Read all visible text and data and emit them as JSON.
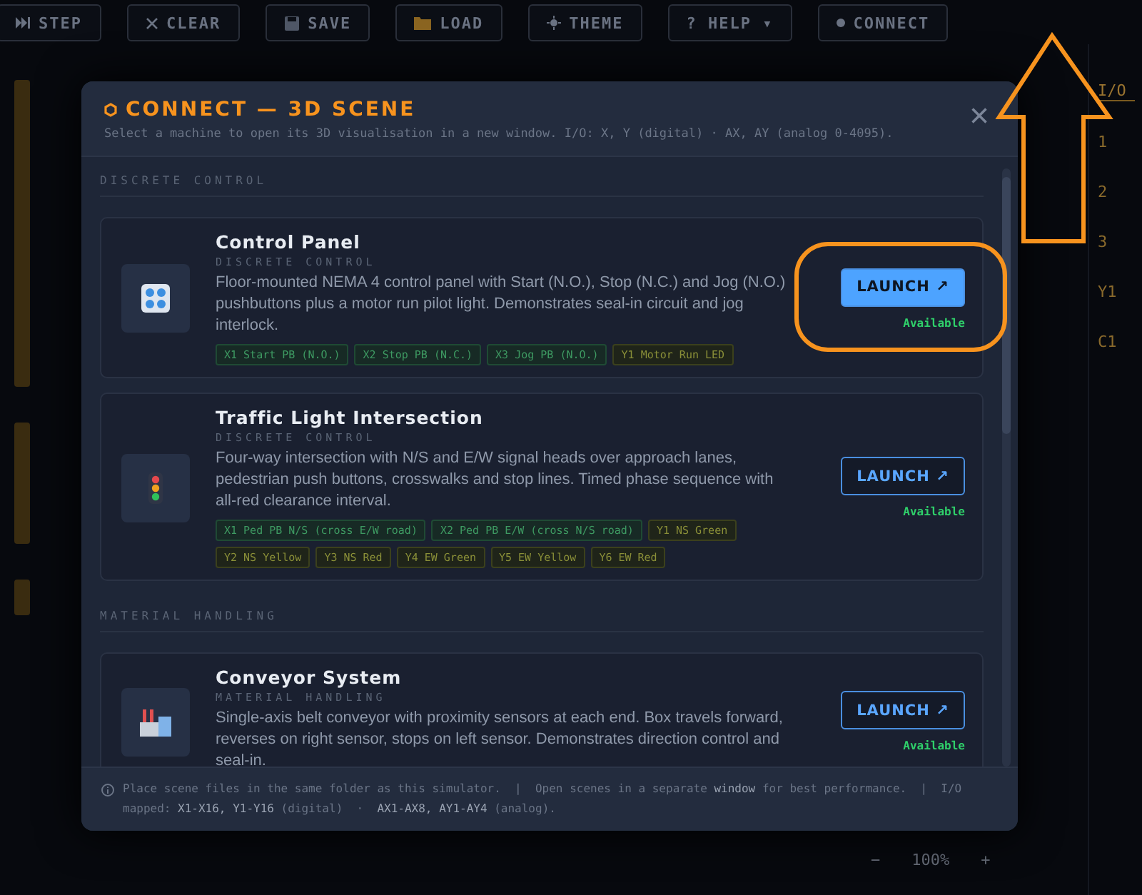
{
  "toolbar": [
    {
      "label": "STEP"
    },
    {
      "label": "CLEAR"
    },
    {
      "label": "SAVE"
    },
    {
      "label": "LOAD"
    },
    {
      "label": "THEME"
    },
    {
      "label": "? HELP ▾"
    },
    {
      "label": "CONNECT"
    }
  ],
  "side_panel": {
    "tab": "I/O",
    "rows": [
      "1",
      "2",
      "3",
      "Y1",
      "C1"
    ]
  },
  "zoom_bar": {
    "minus": "−",
    "value": "100%",
    "plus": "+"
  },
  "modal": {
    "title": "CONNECT — 3D SCENE",
    "subtitle": "Select a machine to open its 3D visualisation in a new window. I/O: X, Y (digital) · AX, AY (analog 0-4095).",
    "close": "×",
    "sections": [
      {
        "heading": "DISCRETE CONTROL",
        "machines": [
          {
            "name": "Control Panel",
            "category": "DISCRETE CONTROL",
            "description": "Floor-mounted NEMA 4 control panel with Start (N.O.), Stop (N.C.) and Jog (N.O.) pushbuttons plus a motor run pilot light. Demonstrates seal-in circuit and jog interlock.",
            "primary": true,
            "launch": "LAUNCH ↗",
            "status": "Available",
            "chips": [
              {
                "kind": "input",
                "label": "X1 Start PB (N.O.)"
              },
              {
                "kind": "input",
                "label": "X2 Stop PB (N.C.)"
              },
              {
                "kind": "input",
                "label": "X3 Jog PB (N.O.)"
              },
              {
                "kind": "output",
                "label": "Y1 Motor Run LED"
              }
            ]
          },
          {
            "name": "Traffic Light Intersection",
            "category": "DISCRETE CONTROL",
            "description": "Four-way intersection with N/S and E/W signal heads over approach lanes, pedestrian push buttons, crosswalks and stop lines. Timed phase sequence with all-red clearance interval.",
            "primary": false,
            "launch": "LAUNCH ↗",
            "status": "Available",
            "chips": [
              {
                "kind": "input",
                "label": "X1 Ped PB N/S (cross E/W road)"
              },
              {
                "kind": "input",
                "label": "X2 Ped PB E/W (cross N/S road)"
              },
              {
                "kind": "output",
                "label": "Y1 NS Green"
              },
              {
                "kind": "output",
                "label": "Y2 NS Yellow"
              },
              {
                "kind": "output",
                "label": "Y3 NS Red"
              },
              {
                "kind": "output",
                "label": "Y4 EW Green"
              },
              {
                "kind": "output",
                "label": "Y5 EW Yellow"
              },
              {
                "kind": "output",
                "label": "Y6 EW Red"
              }
            ]
          }
        ]
      },
      {
        "heading": "MATERIAL HANDLING",
        "machines": [
          {
            "name": "Conveyor System",
            "category": "MATERIAL HANDLING",
            "description": "Single-axis belt conveyor with proximity sensors at each end. Box travels forward, reverses on right sensor, stops on left sensor. Demonstrates direction control and seal-in.",
            "primary": false,
            "launch": "LAUNCH ↗",
            "status": "Available"
          }
        ]
      }
    ],
    "footer": "Place scene files in the same folder as this simulator.  |  Open scenes in a separate **window** for best performance.  |  I/O mapped: **X1-X16, Y1-Y16** (digital)  ·  **AX1-AX8, AY1-AY4** (analog)."
  }
}
